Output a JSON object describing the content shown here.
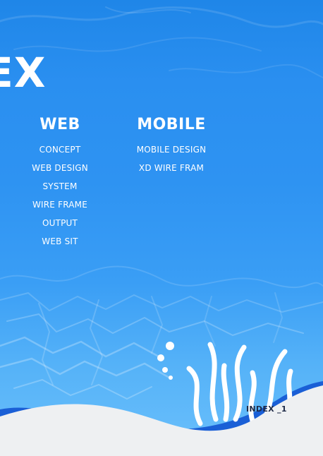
{
  "title": "DEX",
  "web": {
    "heading": "WEB",
    "items": [
      "CONCEPT",
      "WEB DESIGN",
      "SYSTEM",
      "WIRE FRAME",
      "OUTPUT",
      "WEB SIT"
    ]
  },
  "mobile": {
    "heading": "MOBILE",
    "items": [
      "MOBILE DESIGN",
      "XD WIRE FRAM"
    ]
  },
  "page_label": "INDEX _1",
  "colors": {
    "water": "#2e93f2",
    "wave_dark": "#1a5fd6",
    "wave_light": "#eef0f2",
    "text": "#ffffff",
    "label": "#1d2a47"
  }
}
